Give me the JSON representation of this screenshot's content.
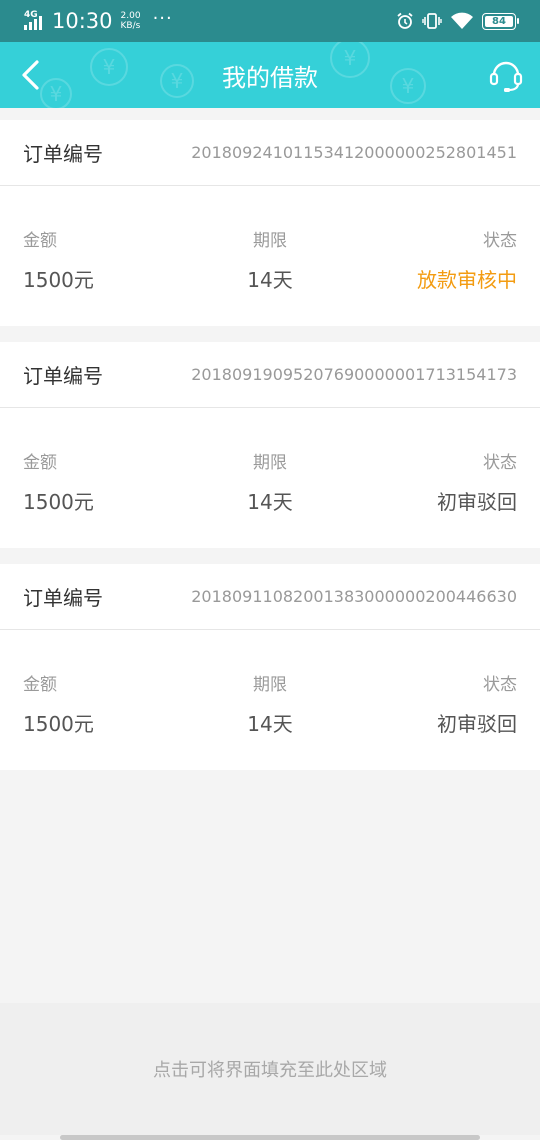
{
  "status_bar": {
    "network": "4G",
    "time": "10:30",
    "speed_value": "2.00",
    "speed_unit": "KB/s",
    "more": "···",
    "battery": "84"
  },
  "header": {
    "title": "我的借款",
    "back_icon": "chevron-left-icon",
    "service_icon": "headset-icon"
  },
  "orders": [
    {
      "order_label": "订单编号",
      "order_no": "20180924101153412000000252801451",
      "amount_label": "金额",
      "amount": "1500元",
      "term_label": "期限",
      "term": "14天",
      "status_label": "状态",
      "status": "放款审核中"
    },
    {
      "order_label": "订单编号",
      "order_no": "20180919095207690000001713154173",
      "amount_label": "金额",
      "amount": "1500元",
      "term_label": "期限",
      "term": "14天",
      "status_label": "状态",
      "status": "初审驳回"
    },
    {
      "order_label": "订单编号",
      "order_no": "20180911082001383000000200446630",
      "amount_label": "金额",
      "amount": "1500元",
      "term_label": "期限",
      "term": "14天",
      "status_label": "状态",
      "status": "初审驳回"
    }
  ],
  "colors": {
    "header": "#35d0d8",
    "status_bar": "#2b8b8e",
    "status_pending": "#f39c12",
    "status_rejected": "#555555"
  },
  "fill_hint": "点击可将界面填充至此处区域"
}
